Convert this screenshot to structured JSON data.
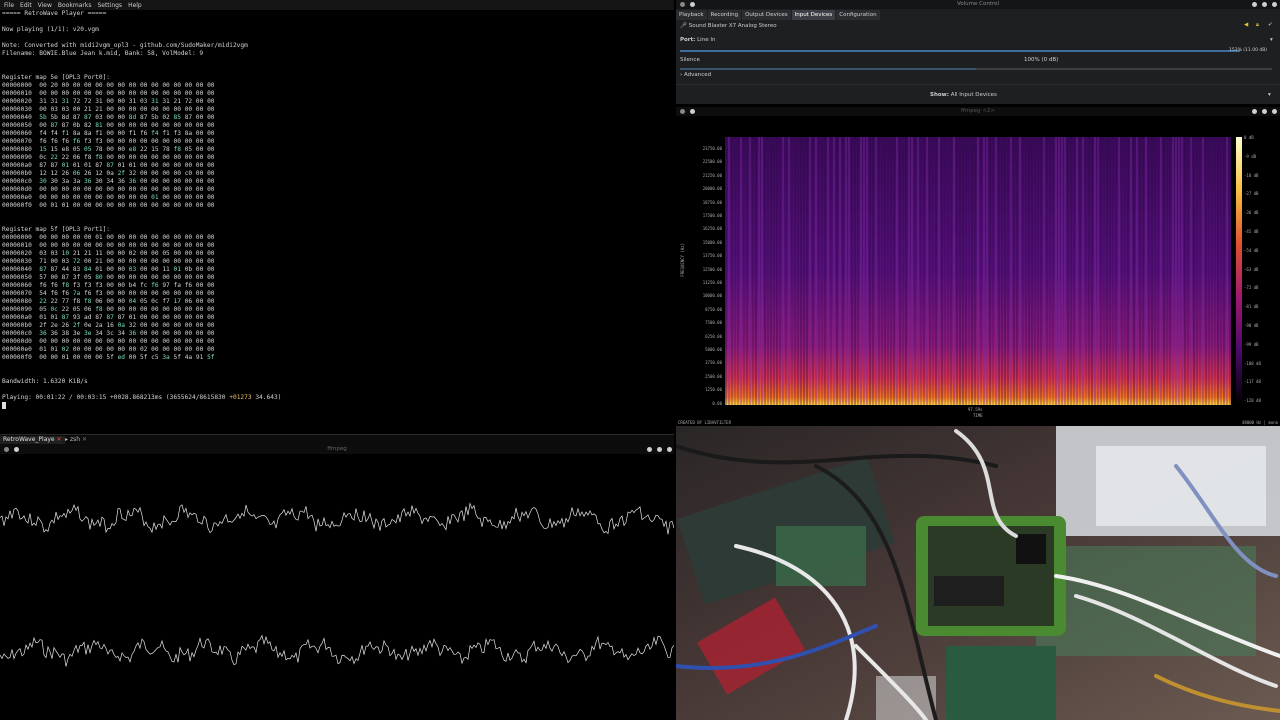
{
  "terminal": {
    "menu": [
      "File",
      "Edit",
      "View",
      "Bookmarks",
      "Settings",
      "Help"
    ],
    "header": "===== RetroWave Player =====",
    "now_playing": "Now playing (1/1): v20.vgm",
    "note": "Note: Converted with midi2vgm_opl3 - github.com/SudoMaker/midi2vgm",
    "filename": "Filename: BOWIE.Blue Jean k.mid, Bank: 58, VolModel: 9",
    "map0_title": "Register map 5e [OPL3 Port0]:",
    "map0_rows": [
      [
        "00000000",
        "00 20 00 00 00 00 00 00 00 00 00 00 00 00 00 00"
      ],
      [
        "00000010",
        "00 00 00 00 00 00 00 00 00 00 00 00 00 00 00 00"
      ],
      [
        "00000020",
        "31 31 31 72 72 31 00 00 31 03 31 31 21 72 00 00"
      ],
      [
        "00000030",
        "00 03 03 00 21 21 00 00 00 00 00 00 00 00 00 00"
      ],
      [
        "00000040",
        "5b 5b 8d 87 87 03 00 00 8d 87 5b 02 85 87 00 00"
      ],
      [
        "00000050",
        "00 87 87 0b 82 81 00 00 00 00 00 00 00 00 00 00"
      ],
      [
        "00000060",
        "f4 f4 f1 8a 8a f1 00 00 f1 f6 f4 f1 f3 8a 00 00"
      ],
      [
        "00000070",
        "f6 f6 f6 f6 f3 f3 00 00 00 00 00 00 00 00 00 00"
      ],
      [
        "00000080",
        "15 15 e8 05 05 78 00 00 e8 22 15 78 f8 05 00 00"
      ],
      [
        "00000090",
        "0c 22 22 06 f8 f8 00 00 00 00 00 00 00 00 00 00"
      ],
      [
        "000000a0",
        "87 87 01 01 01 87 87 01 01 00 00 00 00 00 00 00"
      ],
      [
        "000000b0",
        "12 12 26 06 26 12 0a 2f 32 00 00 00 00 c0 00 00"
      ],
      [
        "000000c0",
        "30 30 3a 3a 36 30 34 36 36 00 00 00 00 00 00 00"
      ],
      [
        "000000d0",
        "00 00 00 00 00 00 00 00 00 00 00 00 00 00 00 00"
      ],
      [
        "000000e0",
        "00 00 00 00 00 00 00 00 00 00 01 00 00 00 00 00"
      ],
      [
        "000000f0",
        "00 01 01 00 00 00 00 00 00 00 00 00 00 00 00 00"
      ]
    ],
    "map1_title": "Register map 5f [OPL3 Port1]:",
    "map1_rows": [
      [
        "00000000",
        "00 00 00 00 00 01 00 00 00 00 00 00 00 00 00 00"
      ],
      [
        "00000010",
        "00 00 00 00 00 00 00 00 00 00 00 00 00 00 00 00"
      ],
      [
        "00000020",
        "03 03 10 21 21 11 00 00 02 00 00 05 00 00 00 00"
      ],
      [
        "00000030",
        "71 00 03 72 00 21 00 00 00 00 00 00 00 00 00 00"
      ],
      [
        "00000040",
        "87 87 44 83 84 01 00 00 03 00 00 11 01 0b 00 00"
      ],
      [
        "00000050",
        "57 00 87 3f 05 80 00 00 00 00 00 00 00 00 00 00"
      ],
      [
        "00000060",
        "f6 f6 f8 f3 f3 f3 00 00 b4 fc f6 97 fa f6 00 00"
      ],
      [
        "00000070",
        "54 f6 f6 7a f6 f3 00 00 00 00 00 00 00 00 00 00"
      ],
      [
        "00000080",
        "22 22 77 f8 f8 06 00 00 04 05 0c f7 17 06 00 00"
      ],
      [
        "00000090",
        "05 0c 22 05 06 f8 00 00 00 00 00 00 00 00 00 00"
      ],
      [
        "000000a0",
        "01 01 87 93 ad 87 87 87 01 00 00 00 00 00 00 00"
      ],
      [
        "000000b0",
        "2f 2e 26 2f 0e 2a 16 0a 32 00 00 00 00 00 00 00"
      ],
      [
        "000000c0",
        "36 36 38 3e 3e 34 3c 34 36 00 00 00 00 00 00 00"
      ],
      [
        "000000d0",
        "00 00 00 00 00 00 00 00 00 00 00 00 00 00 00 00"
      ],
      [
        "000000e0",
        "01 01 02 00 00 00 00 00 00 02 00 00 00 00 00 00"
      ],
      [
        "000000f0",
        "00 00 01 00 00 00 5f ed 00 5f c5 3a 5f 4a 91 5f"
      ]
    ],
    "bandwidth": "Bandwidth: 1.6320 KiB/s",
    "playing_prefix": "Playing: 00:01:22 / 00:03:15 +0028.868213ms (3655624/8615830 ",
    "playing_highlight": "+01273",
    "playing_suffix": " 34.643)",
    "tabs": [
      "RetroWave_Playe",
      "zsh"
    ],
    "waveform_title": "ffmpeg"
  },
  "volume_control": {
    "title": "Volume Control",
    "tabs": [
      "Playback",
      "Recording",
      "Output Devices",
      "Input Devices",
      "Configuration"
    ],
    "device": "Sound Blaster X7 Analog Stereo",
    "port_label": "Port:",
    "port_value": "Line In",
    "big_value": "153% (11.00 dB)",
    "silence_label": "Silence",
    "level_value": "100% (0 dB)",
    "level_fraction": 0.5,
    "advanced": "Advanced",
    "show_label": "Show:",
    "show_value": "All Input Devices"
  },
  "spectrum": {
    "title": "ffmpeg <2>",
    "y_ticks": [
      "23750.00",
      "22500.00",
      "21250.00",
      "20000.00",
      "18750.00",
      "17500.00",
      "16250.00",
      "15000.00",
      "13750.00",
      "12500.00",
      "11250.00",
      "10000.00",
      "8750.00",
      "7500.00",
      "6250.00",
      "5000.00",
      "3750.00",
      "2500.00",
      "1250.00",
      "0.00"
    ],
    "y_label": "FREQUENCY (Hz)",
    "db_ticks": [
      "0 dB",
      "-9 dB",
      "-18 dB",
      "-27 dB",
      "-36 dB",
      "-45 dB",
      "-54 dB",
      "-63 dB",
      "-72 dB",
      "-81 dB",
      "-90 dB",
      "-99 dB",
      "-108 dB",
      "-117 dB",
      "-120 dB"
    ],
    "x_label": "97.59s",
    "x_sub": "TIME",
    "credit": "CREATED BY LIBAVFILTER",
    "info": "48000 Hz | mono"
  }
}
